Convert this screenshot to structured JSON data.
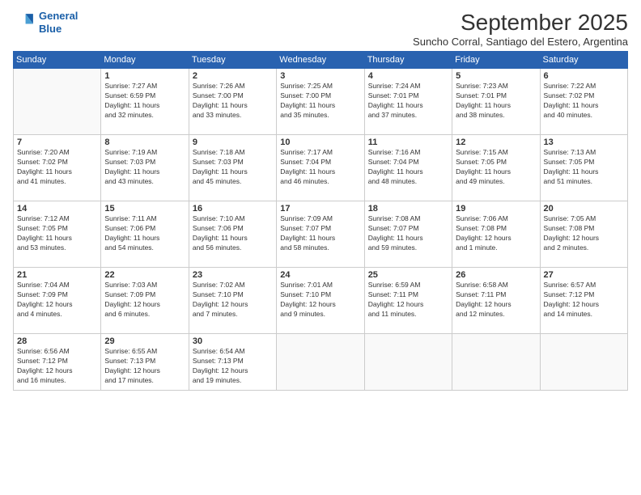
{
  "logo": {
    "line1": "General",
    "line2": "Blue"
  },
  "title": "September 2025",
  "subtitle": "Suncho Corral, Santiago del Estero, Argentina",
  "days_header": [
    "Sunday",
    "Monday",
    "Tuesday",
    "Wednesday",
    "Thursday",
    "Friday",
    "Saturday"
  ],
  "weeks": [
    [
      {
        "day": "",
        "info": ""
      },
      {
        "day": "1",
        "info": "Sunrise: 7:27 AM\nSunset: 6:59 PM\nDaylight: 11 hours\nand 32 minutes."
      },
      {
        "day": "2",
        "info": "Sunrise: 7:26 AM\nSunset: 7:00 PM\nDaylight: 11 hours\nand 33 minutes."
      },
      {
        "day": "3",
        "info": "Sunrise: 7:25 AM\nSunset: 7:00 PM\nDaylight: 11 hours\nand 35 minutes."
      },
      {
        "day": "4",
        "info": "Sunrise: 7:24 AM\nSunset: 7:01 PM\nDaylight: 11 hours\nand 37 minutes."
      },
      {
        "day": "5",
        "info": "Sunrise: 7:23 AM\nSunset: 7:01 PM\nDaylight: 11 hours\nand 38 minutes."
      },
      {
        "day": "6",
        "info": "Sunrise: 7:22 AM\nSunset: 7:02 PM\nDaylight: 11 hours\nand 40 minutes."
      }
    ],
    [
      {
        "day": "7",
        "info": "Sunrise: 7:20 AM\nSunset: 7:02 PM\nDaylight: 11 hours\nand 41 minutes."
      },
      {
        "day": "8",
        "info": "Sunrise: 7:19 AM\nSunset: 7:03 PM\nDaylight: 11 hours\nand 43 minutes."
      },
      {
        "day": "9",
        "info": "Sunrise: 7:18 AM\nSunset: 7:03 PM\nDaylight: 11 hours\nand 45 minutes."
      },
      {
        "day": "10",
        "info": "Sunrise: 7:17 AM\nSunset: 7:04 PM\nDaylight: 11 hours\nand 46 minutes."
      },
      {
        "day": "11",
        "info": "Sunrise: 7:16 AM\nSunset: 7:04 PM\nDaylight: 11 hours\nand 48 minutes."
      },
      {
        "day": "12",
        "info": "Sunrise: 7:15 AM\nSunset: 7:05 PM\nDaylight: 11 hours\nand 49 minutes."
      },
      {
        "day": "13",
        "info": "Sunrise: 7:13 AM\nSunset: 7:05 PM\nDaylight: 11 hours\nand 51 minutes."
      }
    ],
    [
      {
        "day": "14",
        "info": "Sunrise: 7:12 AM\nSunset: 7:05 PM\nDaylight: 11 hours\nand 53 minutes."
      },
      {
        "day": "15",
        "info": "Sunrise: 7:11 AM\nSunset: 7:06 PM\nDaylight: 11 hours\nand 54 minutes."
      },
      {
        "day": "16",
        "info": "Sunrise: 7:10 AM\nSunset: 7:06 PM\nDaylight: 11 hours\nand 56 minutes."
      },
      {
        "day": "17",
        "info": "Sunrise: 7:09 AM\nSunset: 7:07 PM\nDaylight: 11 hours\nand 58 minutes."
      },
      {
        "day": "18",
        "info": "Sunrise: 7:08 AM\nSunset: 7:07 PM\nDaylight: 11 hours\nand 59 minutes."
      },
      {
        "day": "19",
        "info": "Sunrise: 7:06 AM\nSunset: 7:08 PM\nDaylight: 12 hours\nand 1 minute."
      },
      {
        "day": "20",
        "info": "Sunrise: 7:05 AM\nSunset: 7:08 PM\nDaylight: 12 hours\nand 2 minutes."
      }
    ],
    [
      {
        "day": "21",
        "info": "Sunrise: 7:04 AM\nSunset: 7:09 PM\nDaylight: 12 hours\nand 4 minutes."
      },
      {
        "day": "22",
        "info": "Sunrise: 7:03 AM\nSunset: 7:09 PM\nDaylight: 12 hours\nand 6 minutes."
      },
      {
        "day": "23",
        "info": "Sunrise: 7:02 AM\nSunset: 7:10 PM\nDaylight: 12 hours\nand 7 minutes."
      },
      {
        "day": "24",
        "info": "Sunrise: 7:01 AM\nSunset: 7:10 PM\nDaylight: 12 hours\nand 9 minutes."
      },
      {
        "day": "25",
        "info": "Sunrise: 6:59 AM\nSunset: 7:11 PM\nDaylight: 12 hours\nand 11 minutes."
      },
      {
        "day": "26",
        "info": "Sunrise: 6:58 AM\nSunset: 7:11 PM\nDaylight: 12 hours\nand 12 minutes."
      },
      {
        "day": "27",
        "info": "Sunrise: 6:57 AM\nSunset: 7:12 PM\nDaylight: 12 hours\nand 14 minutes."
      }
    ],
    [
      {
        "day": "28",
        "info": "Sunrise: 6:56 AM\nSunset: 7:12 PM\nDaylight: 12 hours\nand 16 minutes."
      },
      {
        "day": "29",
        "info": "Sunrise: 6:55 AM\nSunset: 7:13 PM\nDaylight: 12 hours\nand 17 minutes."
      },
      {
        "day": "30",
        "info": "Sunrise: 6:54 AM\nSunset: 7:13 PM\nDaylight: 12 hours\nand 19 minutes."
      },
      {
        "day": "",
        "info": ""
      },
      {
        "day": "",
        "info": ""
      },
      {
        "day": "",
        "info": ""
      },
      {
        "day": "",
        "info": ""
      }
    ]
  ]
}
